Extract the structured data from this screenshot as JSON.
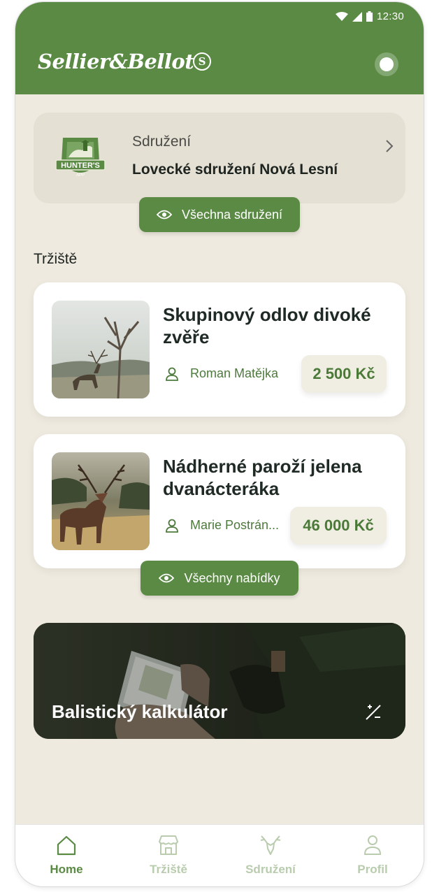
{
  "status_bar": {
    "time": "12:30",
    "icons": [
      "wifi-icon",
      "signal-icon",
      "battery-icon"
    ]
  },
  "header": {
    "brand": "Sellier&Bellot",
    "brand_seal": "S",
    "toggle_icon": "circle-toggle-icon"
  },
  "association": {
    "logo_text": "HUNTER'S",
    "logo_subtext": "APP",
    "kicker": "Sdružení",
    "name": "Lovecké sdružení Nová Lesní",
    "all_button": "Všechna sdružení"
  },
  "market": {
    "title": "Tržiště",
    "offers": [
      {
        "title": "Skupinový odlov divoké zvěře",
        "user": "Roman Matějka",
        "price": "2 500 Kč"
      },
      {
        "title": "Nádherné paroží jelena dvanácteráka",
        "user": "Marie Postrán...",
        "price": "46 000 Kč"
      }
    ],
    "all_button": "Všechny nabídky"
  },
  "calculator": {
    "title": "Balistický kalkulátor",
    "icon": "plus-minus-icon"
  },
  "tabs": [
    {
      "label": "Home",
      "icon": "home-icon",
      "active": true
    },
    {
      "label": "Tržiště",
      "icon": "store-icon",
      "active": false
    },
    {
      "label": "Sdružení",
      "icon": "deer-icon",
      "active": false
    },
    {
      "label": "Profil",
      "icon": "user-icon",
      "active": false
    }
  ],
  "colors": {
    "primary": "#5a8a43",
    "background": "#eeeadf",
    "card_muted": "#e4e0d4",
    "inactive_tab": "#b9ccae"
  }
}
